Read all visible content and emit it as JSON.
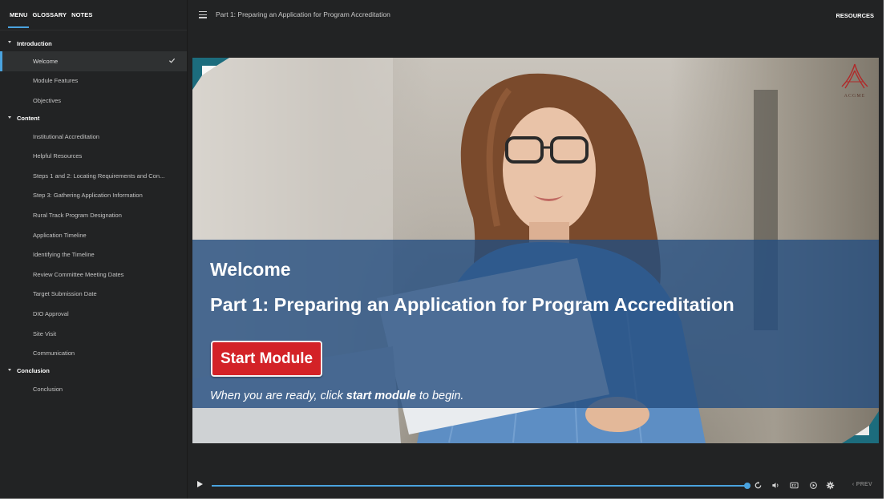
{
  "sidebar": {
    "tabs": [
      {
        "label": "MENU"
      },
      {
        "label": "GLOSSARY"
      },
      {
        "label": "NOTES"
      }
    ],
    "sections": [
      {
        "title": "Introduction",
        "items": [
          {
            "label": "Welcome"
          },
          {
            "label": "Module Features"
          },
          {
            "label": "Objectives"
          }
        ]
      },
      {
        "title": "Content",
        "items": [
          {
            "label": "Institutional Accreditation"
          },
          {
            "label": "Helpful Resources"
          },
          {
            "label": "Steps 1 and 2: Locating Requirements and Con..."
          },
          {
            "label": "Step 3: Gathering Application Information"
          },
          {
            "label": "Rural Track Program Designation"
          },
          {
            "label": "Application Timeline"
          },
          {
            "label": "Identifying the Timeline"
          },
          {
            "label": "Review Committee Meeting Dates"
          },
          {
            "label": "Target Submission Date"
          },
          {
            "label": "DIO Approval"
          },
          {
            "label": "Site Visit"
          },
          {
            "label": "Communication"
          }
        ]
      },
      {
        "title": "Conclusion",
        "items": [
          {
            "label": "Conclusion"
          }
        ]
      }
    ]
  },
  "header": {
    "title": "Part 1: Preparing an Application for Program Accreditation",
    "resources_label": "RESOURCES"
  },
  "slide": {
    "logo_text": "ACGME",
    "welcome": "Welcome",
    "subtitle": "Part 1: Preparing an Application for Program Accreditation",
    "start_button": "Start Module",
    "instruction_before": "When you are ready, click ",
    "instruction_bold": "start module",
    "instruction_after": " to begin."
  },
  "player": {
    "prev_label": "PREV"
  },
  "colors": {
    "accent": "#4aa3df",
    "start_button": "#d32227",
    "banner": "#244e80",
    "panel": "#222324"
  }
}
